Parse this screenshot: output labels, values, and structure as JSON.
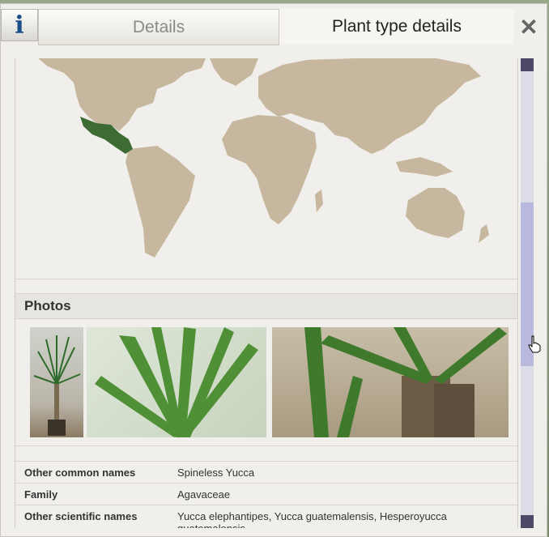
{
  "header": {
    "info_icon_glyph": "i",
    "tab_details": "Details",
    "tab_plant_type": "Plant type details",
    "close_glyph": "✕"
  },
  "map": {
    "land_color": "#c7b79e",
    "highlight_color": "#3e6b33"
  },
  "photos": {
    "heading": "Photos",
    "items": [
      "yucca-potted-plant-photo",
      "yucca-leaves-closeup-photo",
      "yucca-trunk-closeup-photo"
    ]
  },
  "properties": [
    {
      "label": "Other common names",
      "value": "Spineless Yucca"
    },
    {
      "label": "Family",
      "value": "Agavaceae"
    },
    {
      "label": "Other scientific names",
      "value": "Yucca elephantipes, Yucca guatemalensis, Hesperoyucca guatemalensis"
    }
  ],
  "colors": {
    "accent": "#1a4f8a",
    "scroll_thumb": "#b9b9de",
    "scroll_arrow": "#4d4a68"
  }
}
